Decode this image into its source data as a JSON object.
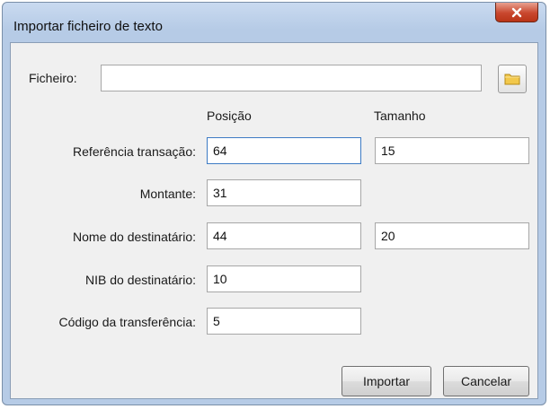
{
  "window": {
    "title": "Importar ficheiro de texto"
  },
  "file": {
    "label": "Ficheiro:",
    "value": ""
  },
  "columns": {
    "position": "Posição",
    "size": "Tamanho"
  },
  "fields": [
    {
      "label": "Referência transação:",
      "position": "64",
      "size": "15"
    },
    {
      "label": "Montante:",
      "position": "31"
    },
    {
      "label": "Nome do destinatário:",
      "position": "44",
      "size": "20"
    },
    {
      "label": "NIB do destinatário:",
      "position": "10"
    },
    {
      "label": "Código da transferência:",
      "position": "5"
    }
  ],
  "buttons": {
    "import": "Importar",
    "cancel": "Cancelar"
  },
  "icons": {
    "close": "close-icon",
    "folder": "folder-icon"
  },
  "colors": {
    "close_button": "#c9472e",
    "folder": "#f2c84b",
    "focus_border": "#3d7bc4"
  }
}
